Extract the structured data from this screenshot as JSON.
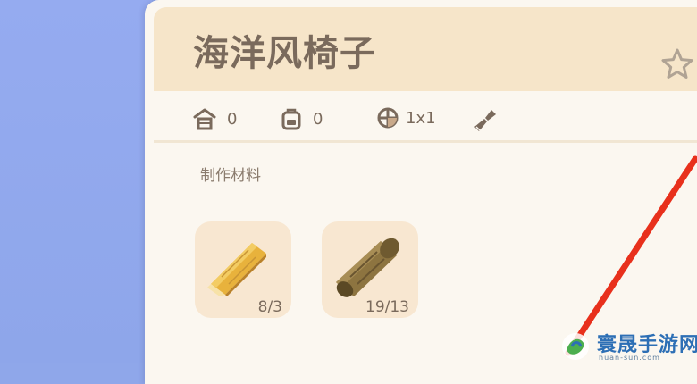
{
  "item": {
    "title": "海洋风椅子"
  },
  "stats": [
    {
      "icon": "storage-icon",
      "value": "0"
    },
    {
      "icon": "backpack-icon",
      "value": "0"
    },
    {
      "icon": "size-grid-icon",
      "value": "1x1"
    },
    {
      "icon": "paint-brush-icon",
      "value": ""
    }
  ],
  "materials": {
    "label": "制作材料",
    "items": [
      {
        "icon": "lumber-icon",
        "count": "8/3"
      },
      {
        "icon": "hardwood-log-icon",
        "count": "19/13"
      }
    ]
  },
  "watermark": {
    "text": "寰晟手游网",
    "subtext": "huan-sun.com"
  },
  "colors": {
    "background": "#8fa7ea",
    "panel": "#fbf7f0",
    "header": "#f6e5c9",
    "tile": "#f8e7d1",
    "text": "#7a6a5c",
    "annotation_red": "#e8301c"
  }
}
